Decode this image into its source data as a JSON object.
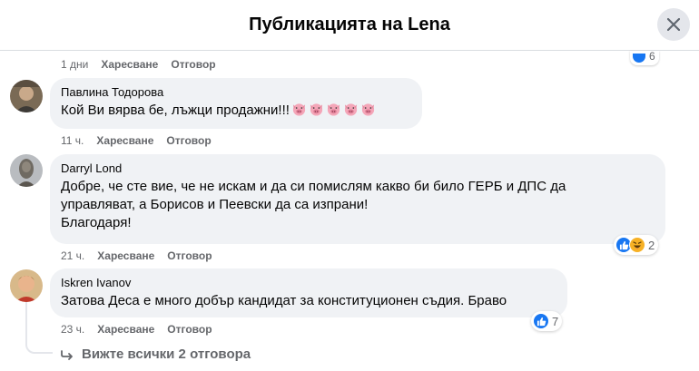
{
  "header": {
    "title": "Публикацията на Lena",
    "close_icon": "close-icon"
  },
  "top_meta": {
    "time": "1 дни",
    "like": "Харесване",
    "reply": "Отговор",
    "reaction_count": "6"
  },
  "comments": [
    {
      "author": "Павлина Тодорова",
      "lines": [
        "Кой Ви вярва бе, лъжци продажни!!!"
      ],
      "emoji": "pig-face-emoji",
      "emoji_count": 5,
      "time": "11 ч.",
      "like": "Харесване",
      "reply": "Отговор"
    },
    {
      "author": "Darryl Lond",
      "lines": [
        "Добре, че сте вие, че не искам и да си помислям какво би било ГЕРБ и ДПС да",
        "управляват, а Борисов и Пеевски да са изпрани!",
        "Благодаря!"
      ],
      "time": "21 ч.",
      "like": "Харесване",
      "reply": "Отговор",
      "reaction_count": "2",
      "reaction_icons": [
        "like-icon",
        "haha-icon"
      ]
    },
    {
      "author": "Iskren Ivanov",
      "lines": [
        "Затова Деса е много добър кандидат за конституционен съдия. Браво"
      ],
      "time": "23 ч.",
      "like": "Харесване",
      "reply": "Отговор",
      "reaction_count": "7",
      "reaction_icons": [
        "like-icon"
      ]
    }
  ],
  "view_replies": "Вижте всички 2 отговора",
  "colors": {
    "bubble": "#f0f2f5",
    "meta_text": "#65676b",
    "like_blue": "#1877f2",
    "haha_yellow": "#f7b125"
  }
}
